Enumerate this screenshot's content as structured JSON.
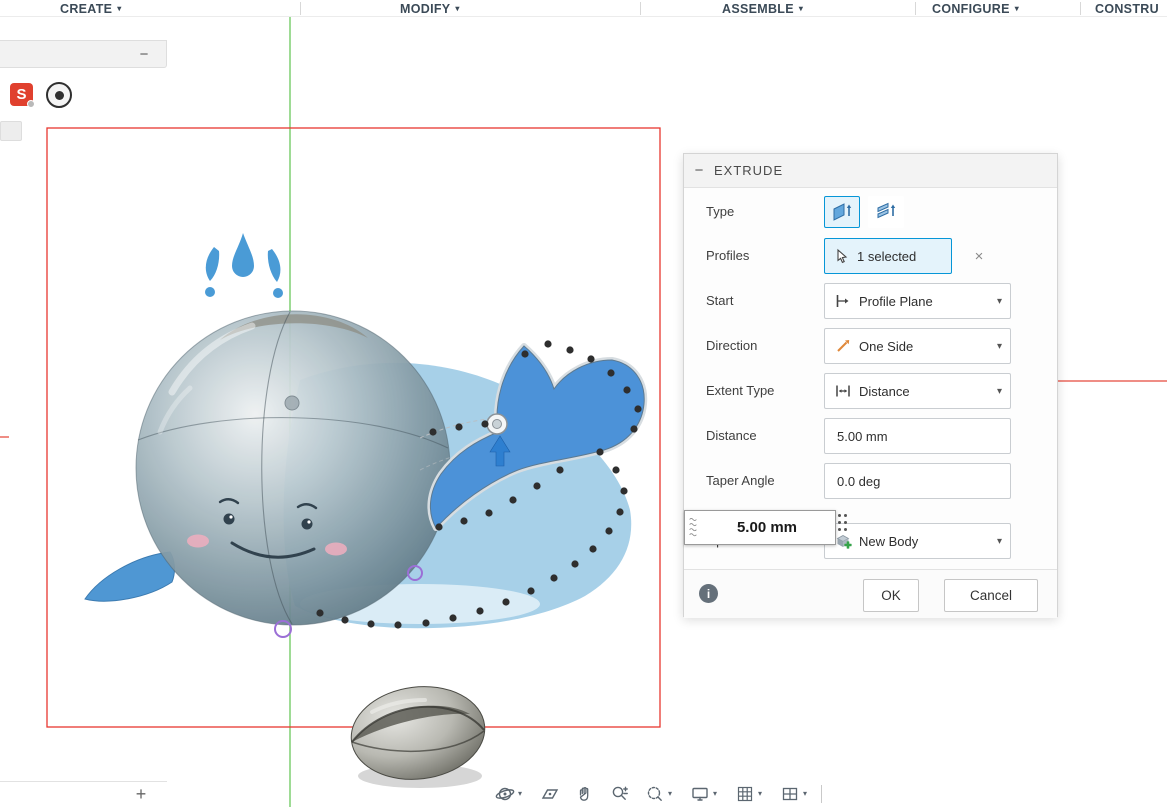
{
  "top_menu": {
    "items": [
      "CREATE",
      "MODIFY",
      "ASSEMBLE",
      "CONFIGURE",
      "CONSTRU"
    ]
  },
  "icons": {
    "caret_down": "▾",
    "minus": "−",
    "plus": "+",
    "close": "×",
    "info": "i",
    "s_logo": "S"
  },
  "dialog": {
    "title": "EXTRUDE",
    "rows": {
      "type_label": "Type",
      "profiles_label": "Profiles",
      "profiles_value": "1 selected",
      "start_label": "Start",
      "start_value": "Profile Plane",
      "direction_label": "Direction",
      "direction_value": "One Side",
      "extent_label": "Extent Type",
      "extent_value": "Distance",
      "distance_label": "Distance",
      "distance_value": "5.00 mm",
      "taper_label": "Taper Angle",
      "taper_value": "0.0 deg",
      "operation_label": "Operation",
      "operation_value": "New Body"
    },
    "footer": {
      "ok": "OK",
      "cancel": "Cancel"
    }
  },
  "floating_input": {
    "value": "5.00 mm"
  },
  "canvas": {
    "colors": {
      "accent": "#0696d7",
      "axis_green": "#7fcf72",
      "axis_red": "#ef8d85",
      "sketch_red": "#e8372f",
      "selection_blue": "#4c92d8"
    }
  },
  "bottom_toolbar": {
    "icon_names": [
      "orbit-icon",
      "look-at-icon",
      "pan-icon",
      "zoom-icon",
      "window-zoom-icon",
      "display-settings-icon",
      "grid-settings-icon",
      "viewports-icon"
    ]
  }
}
